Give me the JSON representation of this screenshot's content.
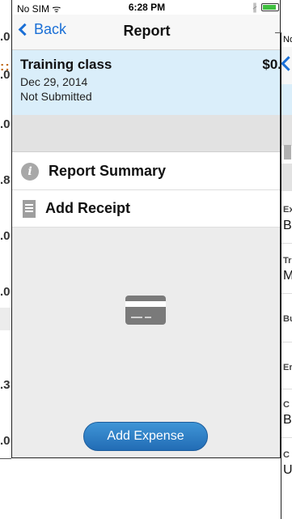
{
  "status_bar": {
    "carrier": "No SIM ᯤ",
    "time": "6:28 PM",
    "bluetooth": "∦"
  },
  "nav": {
    "back_label": "Back",
    "title": "Report"
  },
  "report": {
    "title": "Training class",
    "amount": "$0.",
    "date": "Dec 29, 2014",
    "status": "Not Submitted"
  },
  "menu": {
    "summary_label": "Report Summary",
    "receipt_label": "Add Receipt"
  },
  "empty_state": {
    "add_expense_label": "Add Expense"
  },
  "background_left": {
    "digits": [
      ".0",
      ".0",
      ".0",
      ".8",
      ".0",
      ".0",
      ".3",
      ".0"
    ],
    "dots": "::"
  },
  "background_right": {
    "status": "No",
    "labels": [
      "Ex",
      "Tr",
      "Bu",
      "Er",
      "C",
      "C"
    ],
    "values": [
      "B",
      "M",
      "B",
      "U"
    ]
  },
  "colors": {
    "accent": "#1a6fd6",
    "header_bg": "#daeefa",
    "button": "#2a78c0"
  }
}
